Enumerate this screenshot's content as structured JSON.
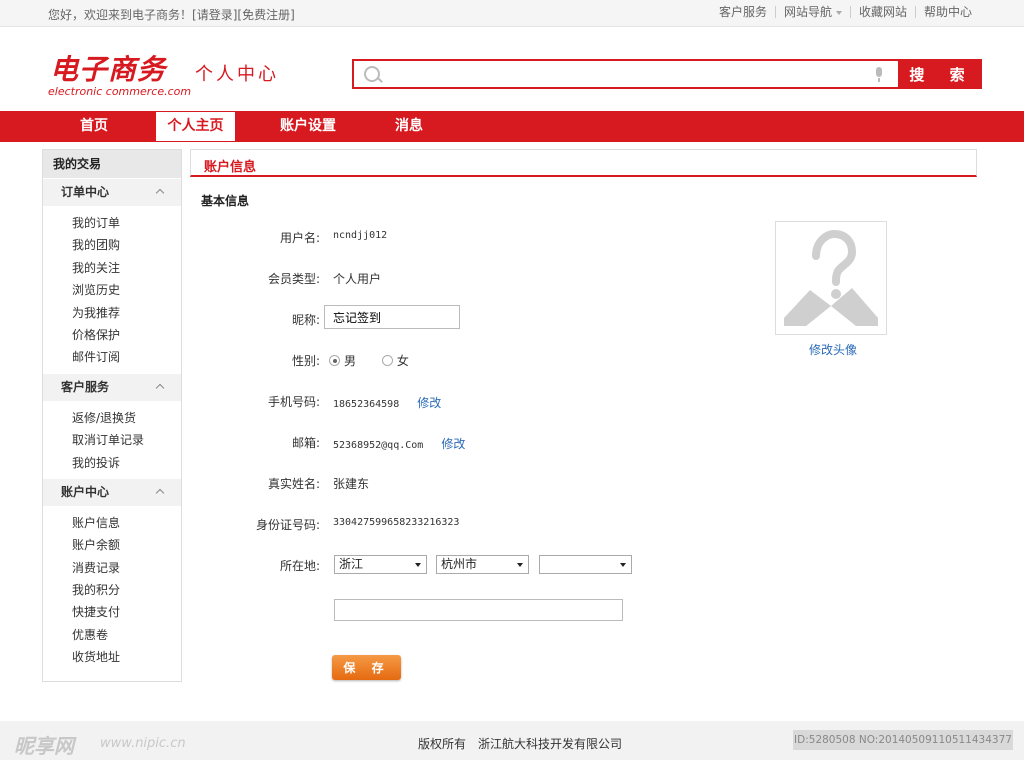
{
  "topbar": {
    "welcome": "您好，欢迎来到电子商务！",
    "login": "[请登录]",
    "register": "[免费注册]",
    "links": [
      "客户服务",
      "网站导航",
      "收藏网站",
      "帮助中心"
    ]
  },
  "header": {
    "logo": "电子商务",
    "logo_sub": "electronic commerce.com",
    "title": "个人中心",
    "search_placeholder": "",
    "search_button": "搜 索"
  },
  "nav": {
    "items": [
      "首页",
      "个人主页",
      "账户设置",
      "消息"
    ],
    "active": "个人主页"
  },
  "sidebar": {
    "title": "我的交易",
    "groups": [
      {
        "title": "订单中心",
        "items": [
          "我的订单",
          "我的团购",
          "我的关注",
          "浏览历史",
          "为我推荐",
          "价格保护",
          "邮件订阅"
        ]
      },
      {
        "title": "客户服务",
        "items": [
          "返修/退换货",
          "取消订单记录",
          "我的投诉"
        ]
      },
      {
        "title": "账户中心",
        "items": [
          "账户信息",
          "账户余额",
          "消费记录",
          "我的积分",
          "快捷支付",
          "优惠卷",
          "收货地址"
        ]
      }
    ]
  },
  "main": {
    "panel_title": "账户信息",
    "section_title": "基本信息",
    "fields": {
      "username_label": "用户名:",
      "username": "ncndjj012",
      "member_type_label": "会员类型:",
      "member_type": "个人用户",
      "nickname_label": "昵称:",
      "nickname": "忘记签到",
      "gender_label": "性别:",
      "gender_male": "男",
      "gender_female": "女",
      "phone_label": "手机号码:",
      "phone": "18652364598",
      "phone_edit": "修改",
      "email_label": "邮箱:",
      "email": "52368952@qq.Com",
      "email_edit": "修改",
      "realname_label": "真实姓名:",
      "realname": "张建东",
      "idcard_label": "身份证号码:",
      "idcard": "330427599658233216323",
      "location_label": "所在地:",
      "province": "浙江",
      "city": "杭州市",
      "district": ""
    },
    "save_button": "保 存",
    "avatar_link": "修改头像"
  },
  "footer": {
    "copyright": "版权所有　浙江航大科技开发有限公司"
  },
  "watermark": {
    "brand": "昵享网",
    "url": "www.nipic.cn",
    "id": "ID:5280508 NO:20140509110511434377"
  },
  "colors": {
    "brand_red": "#d71920",
    "link_blue": "#2a6ab8",
    "save_orange": "#ee7a22"
  }
}
